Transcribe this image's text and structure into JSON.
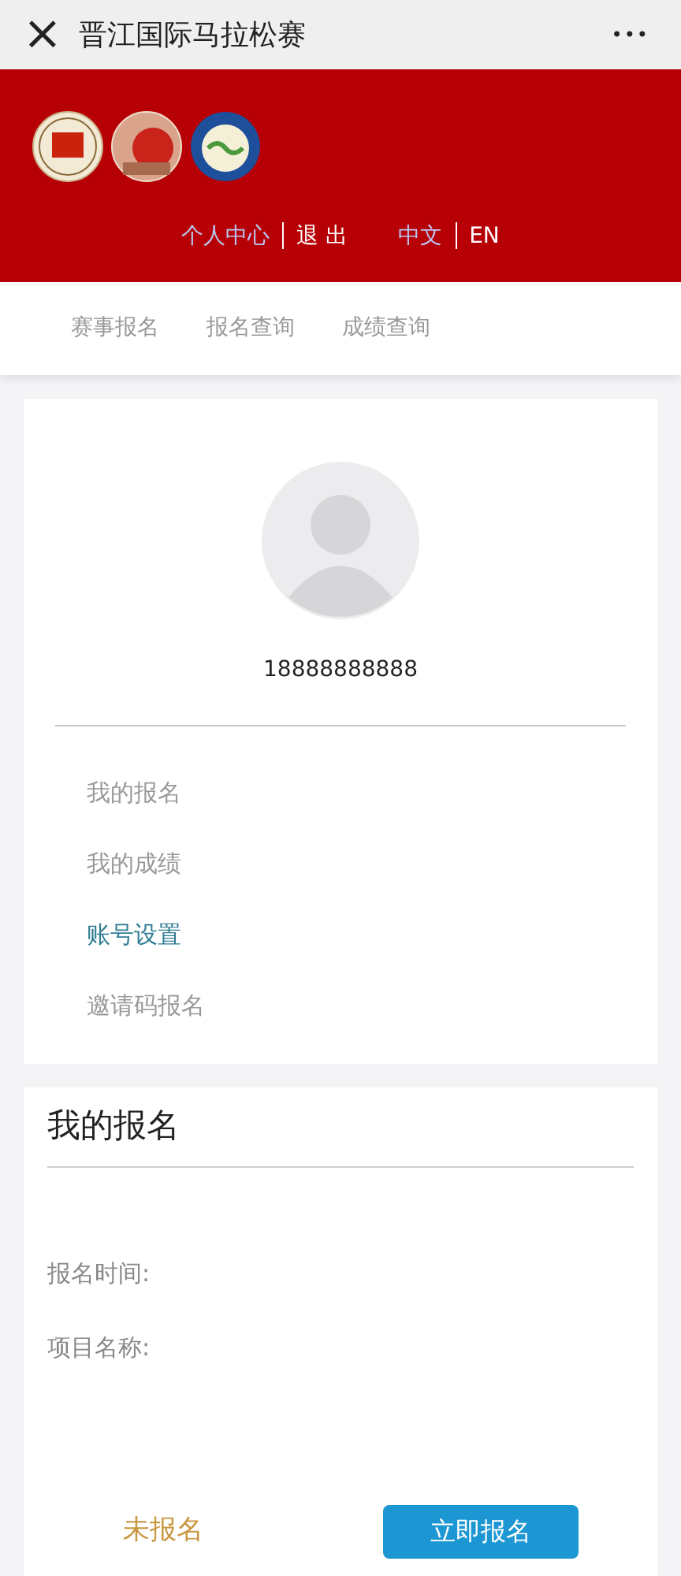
{
  "window": {
    "title": "晋江国际马拉松赛",
    "close": "×",
    "more": "•••"
  },
  "header": {
    "account_links": [
      {
        "label": "个人中心",
        "selected": true
      },
      {
        "label": "退 出",
        "selected": false
      }
    ],
    "languages": [
      {
        "label": "中文",
        "selected": true
      },
      {
        "label": "EN",
        "selected": false
      }
    ]
  },
  "tabs": [
    {
      "label": "赛事报名",
      "selected": false
    },
    {
      "label": "报名查询",
      "selected": false
    },
    {
      "label": "成绩查询",
      "selected": false
    }
  ],
  "profile": {
    "phone": "18888888888"
  },
  "menu": [
    {
      "label": "我的报名",
      "selected": false
    },
    {
      "label": "我的成绩",
      "selected": false
    },
    {
      "label": "账号设置",
      "selected": true
    },
    {
      "label": "邀请码报名",
      "selected": false
    }
  ],
  "registration": {
    "title": "我的报名",
    "fields": [
      "报名时间:",
      "项目名称:"
    ],
    "status": "未报名",
    "button": "立即报名"
  }
}
